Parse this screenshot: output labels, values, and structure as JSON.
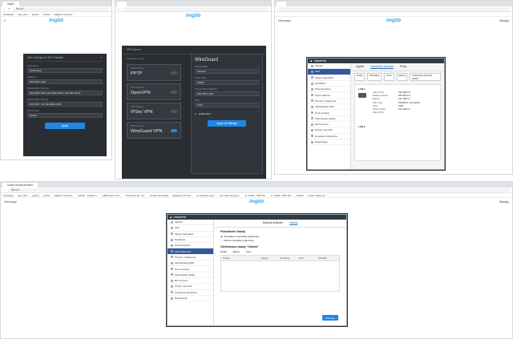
{
  "tile1": {
    "tab": "imgbb",
    "url": "ibb.co/...",
    "bookmarks": [
      "Tanaradio",
      "Sas_Grin",
      "python",
      "Online",
      "Najlepsi Generat..."
    ],
    "logo": "imgbb",
    "dialog_title": "Other settings for Wi-Fi Satellite",
    "fields": [
      {
        "label": "Username",
        "value": "acpbbvalve"
      },
      {
        "label": "Address",
        "value": "192.168.1.2/24"
      },
      {
        "label": "Allowed IPs (Server)",
        "value": "192.168.1.0/24, 192.168.2.0/24, 192.168.3.0/24"
      },
      {
        "label": "Allowed IPs (Client)",
        "value": "0.0.0.0/0, ::/0, 192.168.1.0/24"
      },
      {
        "label": "Secret Key",
        "value": "Device"
      }
    ],
    "apply": "Apply"
  },
  "tile2": {
    "logo": "imgbb",
    "header": "VPN Server",
    "sub": "Operation mode",
    "vpn": [
      {
        "type": "VPN Server",
        "name": "PPTP",
        "on": false
      },
      {
        "type": "VPN Server",
        "name": "OpenVPN",
        "on": false
      },
      {
        "type": "VPN Server",
        "name": "IPSec VPN",
        "on": false
      },
      {
        "type": "VPN Server",
        "name": "WireGuard VPN",
        "on": true
      }
    ],
    "panel_title": "WireGuard",
    "panel_fields": [
      {
        "label": "VPN Details",
        "value": "General"
      },
      {
        "label": "Listen Port",
        "value": "51820"
      },
      {
        "label": "Tunnel IPv4 Address",
        "value": "192.168.1.1/24"
      },
      {
        "label": "MTU",
        "value": "1420"
      }
    ],
    "client": "acpbbvalve",
    "apply_all": "Apply all settings"
  },
  "tile3": {
    "logo": "imgbb",
    "info": "Informacje",
    "login": "Wyloguj",
    "win_title": "Ustawienia",
    "tabs": [
      "Ogólne",
      "Ustawienia sieciowe",
      "Proxy"
    ],
    "subtabs": [
      "Dodaj",
      "Modyfikuj",
      "Usuń",
      "Edytuj",
      "Ustawienia Serwera DHCP"
    ],
    "sidebar": [
      "Ogólne",
      "Sieć",
      "Opcje regionalne",
      "Hardware",
      "Przechowanie",
      "Opóź zakrezu",
      "Monitor urządzenia",
      "Aktualizacja ASM",
      "Konc serwisy",
      "Planowanie zadań",
      "EZ-Connect",
      "Pstryk: wyczyść",
      "Usuwanie fabryczne",
      "Rejestracja"
    ],
    "lan1": "LAN 1",
    "lan_rows": [
      {
        "k": "Adres IPv4",
        "v": "192.168.0.9"
      },
      {
        "k": "Maska podsieci",
        "v": "255.255.0.0"
      },
      {
        "k": "Brama",
        "v": "192.168.0.1"
      },
      {
        "k": "Stan sieci",
        "v": "1000Mb/s, Full duplex"
      },
      {
        "k": "MTU",
        "v": "1500"
      },
      {
        "k": "Serwer DNS",
        "v": "192.168.0.1"
      },
      {
        "k": "Adres IPv6",
        "v": ""
      }
    ],
    "lan2": "LAN 2"
  },
  "tile4": {
    "tab": "Ustaw bezpieczeństwo",
    "url": "ibb.co/...",
    "bookmarks": [
      "Tanaradio",
      "Sas_Grin",
      "python",
      "Online",
      "Najlepsi Generat...",
      "Mobile - Install on...",
      "gBibrarianl.xh.b...",
      "Prostocka.de - Pl...",
      "Puzzle Download",
      "Raspberry Pi OH...",
      "ex-definition (ge...",
      "PH Transfersperm...",
      "K I 0029 - PPP Alli...",
      "K I 0029 - PPP Alli...",
      "EHPIC",
      "Cyber Infinity (fr..."
    ],
    "logo": "imgbb",
    "info": "Informacje",
    "login": "Wyloguj",
    "win_title": "Ustawienia",
    "tabs": [
      "Network defender",
      "Zasady"
    ],
    "sidebar": [
      "Ogólne",
      "Sieć",
      "Opcje regionalne",
      "Hardware",
      "Przechowanie",
      "ASM Defender",
      "Monitor urządzenia",
      "Aktualizacja ASM",
      "Konc serwisy",
      "Planowanie zadań",
      "EZ-Connect",
      "Pstryk: wyczyść",
      "Usuwanie fabryczne",
      "Rejestracja"
    ],
    "policy_title": "Podstawowe Zasady",
    "radio1": "Zezwalaj na wszystkie połączenia",
    "radio2": "Odmów wszystkie połączenia",
    "rules_title": "Zdefiniowane zasady \"Odmów\"",
    "rule_tabs": [
      "Dodaj",
      "Edytuj",
      "Usuń"
    ],
    "cols": [
      "Nazwa",
      "Usługa",
      "IP Adresy",
      "Port",
      "Protokół"
    ],
    "apply": "Zastosuj"
  },
  "colors": {
    "accent": "#1e88e5",
    "dark": "#2a2e33",
    "sidebar_sel": "#2f5aa0"
  }
}
